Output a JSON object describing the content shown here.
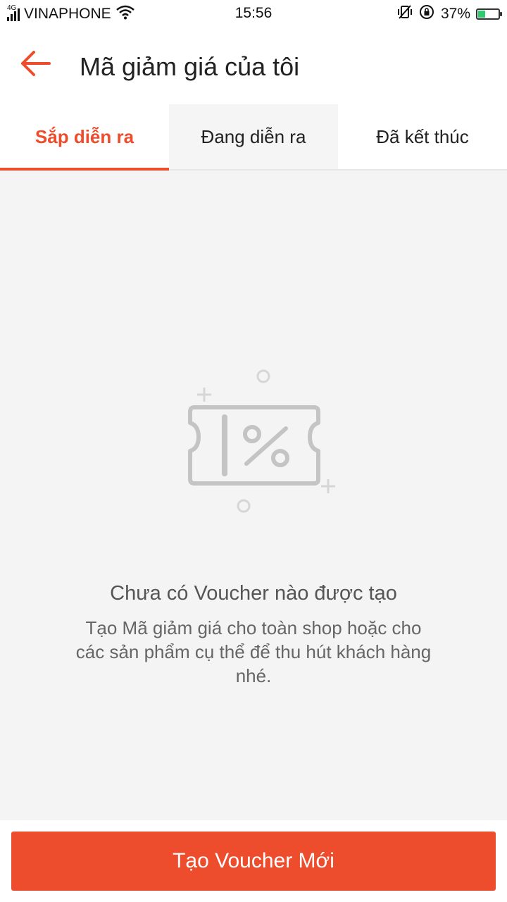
{
  "status_bar": {
    "network": "4G",
    "carrier": "VINAPHONE",
    "time": "15:56",
    "battery": "37%",
    "battery_level": 0.37,
    "icons": [
      "signal-icon",
      "wifi-icon",
      "vibrate-off-icon",
      "rotation-lock-icon",
      "battery-icon"
    ]
  },
  "header": {
    "back_icon": "arrow-left-icon",
    "title": "Mã giảm giá của tôi"
  },
  "tabs": [
    {
      "label": "Sắp diễn ra",
      "active": true
    },
    {
      "label": "Đang diễn ra",
      "active": false
    },
    {
      "label": "Đã kết thúc",
      "active": false
    }
  ],
  "empty_state": {
    "icon": "voucher-percent-icon",
    "title": "Chưa có Voucher nào được tạo",
    "description": "Tạo Mã giảm giá cho toàn shop hoặc cho các sản phẩm cụ thể để thu hút khách hàng nhé."
  },
  "footer": {
    "create_button_label": "Tạo Voucher Mới"
  },
  "colors": {
    "accent": "#ee4d2d",
    "background": "#f4f4f4"
  }
}
